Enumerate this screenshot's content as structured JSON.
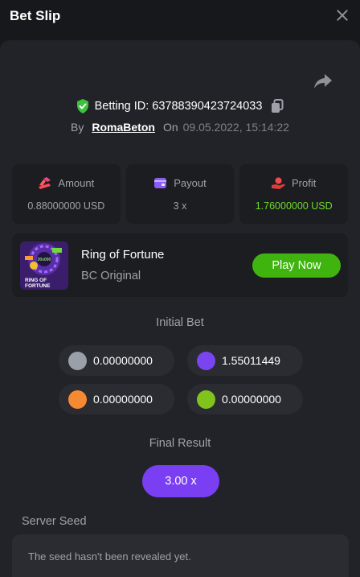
{
  "header": {
    "title": "Bet Slip",
    "close_icon": "close-icon"
  },
  "bet": {
    "id_label": "Betting ID:",
    "id_value": "63788390423724033",
    "by_label": "By",
    "user": "RomaBeton",
    "on_label": "On",
    "date": "09.05.2022, 15:14:22"
  },
  "stats": {
    "amount": {
      "label": "Amount",
      "value": "0.88000000 USD",
      "icon": "coins-icon"
    },
    "payout": {
      "label": "Payout",
      "value": "3 x",
      "icon": "wallet-icon"
    },
    "profit": {
      "label": "Profit",
      "value": "1.76000000 USD",
      "icon": "profit-icon"
    }
  },
  "game": {
    "name": "Ring of Fortune",
    "provider": "BC Original",
    "play_label": "Play Now",
    "thumb_text": [
      "RING OF",
      "FORTUNE"
    ],
    "thumb_badge": "30x000"
  },
  "initial_bet": {
    "label": "Initial Bet",
    "coins": [
      {
        "color": "#9aa0a8",
        "value": "0.00000000"
      },
      {
        "color": "#7a45f0",
        "value": "1.55011449"
      },
      {
        "color": "#f58a33",
        "value": "0.00000000"
      },
      {
        "color": "#80c31d",
        "value": "0.00000000"
      }
    ]
  },
  "final_result": {
    "label": "Final Result",
    "value": "3.00 x"
  },
  "server_seed": {
    "label": "Server Seed",
    "text": "The seed hasn't been revealed yet."
  },
  "colors": {
    "accent_green": "#3fb40f",
    "accent_purple": "#7b3ff3",
    "profit_green": "#6edb2b",
    "panel": "#222328",
    "card": "#1c1d21"
  }
}
